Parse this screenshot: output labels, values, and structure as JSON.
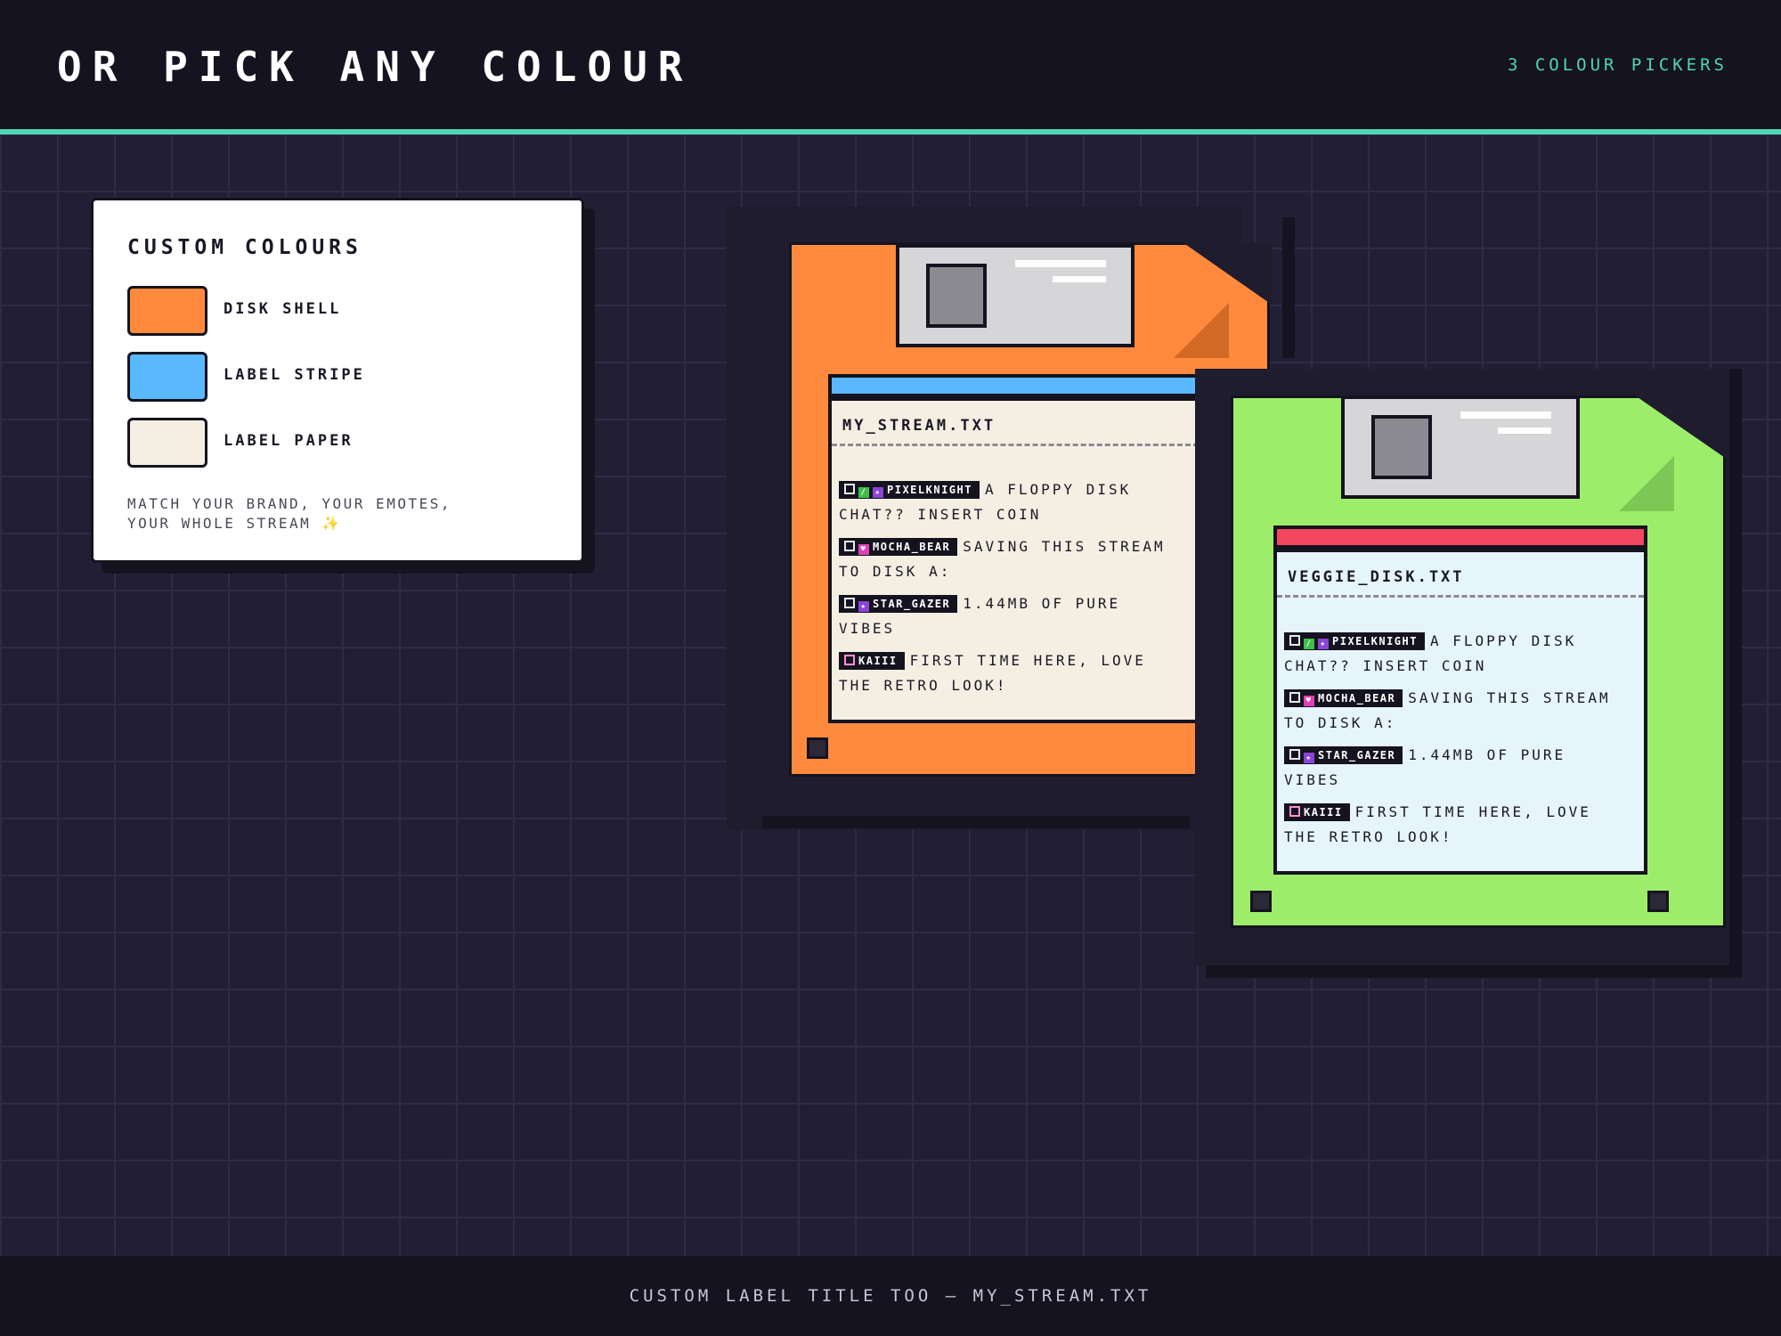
{
  "header": {
    "title": "OR PICK ANY COLOUR",
    "meta": "3 COLOUR PICKERS"
  },
  "panel": {
    "title": "CUSTOM COLOURS",
    "swatches": [
      {
        "label": "DISK SHELL",
        "color": "#ff8a3d"
      },
      {
        "label": "LABEL STRIPE",
        "color": "#5ab8ff"
      },
      {
        "label": "LABEL PAPER",
        "color": "#f4efe2"
      }
    ],
    "note_line1": "MATCH YOUR BRAND, YOUR EMOTES,",
    "note_line2": "YOUR WHOLE STREAM ✨"
  },
  "disk_orange": {
    "label_title": "MY_STREAM.TXT",
    "shell_color": "#ff8a3d",
    "stripe_color": "#5ab8ff",
    "paper_color": "#f4efe2"
  },
  "disk_green": {
    "label_title": "VEGGIE_DISK.TXT",
    "shell_color": "#9ded6a",
    "stripe_color": "#f2475e",
    "paper_color": "#e6f4fb"
  },
  "chat": [
    {
      "user": "PIXELKNIGHT",
      "badges": [
        "square-icon",
        "sword-icon",
        "star-icon"
      ],
      "text": "A FLOPPY DISK CHAT?? INSERT COIN"
    },
    {
      "user": "MOCHA_BEAR",
      "badges": [
        "square-icon",
        "heart-icon"
      ],
      "text": "SAVING THIS STREAM TO DISK A:"
    },
    {
      "user": "STAR_GAZER",
      "badges": [
        "square-icon",
        "star-icon"
      ],
      "text": "1.44MB OF PURE VIBES"
    },
    {
      "user": "KAIII",
      "badges": [
        "square-icon"
      ],
      "text": "FIRST TIME HERE, LOVE THE RETRO LOOK!"
    }
  ],
  "footer": {
    "text": "CUSTOM LABEL TITLE TOO — MY_STREAM.TXT"
  }
}
